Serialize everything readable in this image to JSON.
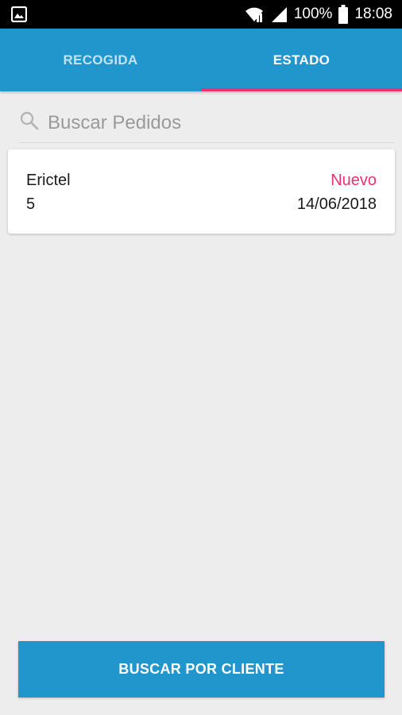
{
  "status_bar": {
    "battery_percent": "100%",
    "time": "18:08",
    "icons": [
      "image-icon",
      "wifi-icon",
      "signal-icon",
      "battery-icon"
    ]
  },
  "tabs": [
    {
      "label": "RECOGIDA",
      "active": false
    },
    {
      "label": "ESTADO",
      "active": true
    }
  ],
  "search": {
    "placeholder": "Buscar Pedidos",
    "value": "",
    "icon": "search-icon"
  },
  "orders": [
    {
      "client": "Erictel",
      "status": "Nuevo",
      "number": "5",
      "date": "14/06/2018"
    }
  ],
  "bottom_button": {
    "label": "BUSCAR POR CLIENTE"
  },
  "colors": {
    "primary": "#2196cc",
    "accent": "#e8336f",
    "background": "#ededed"
  }
}
